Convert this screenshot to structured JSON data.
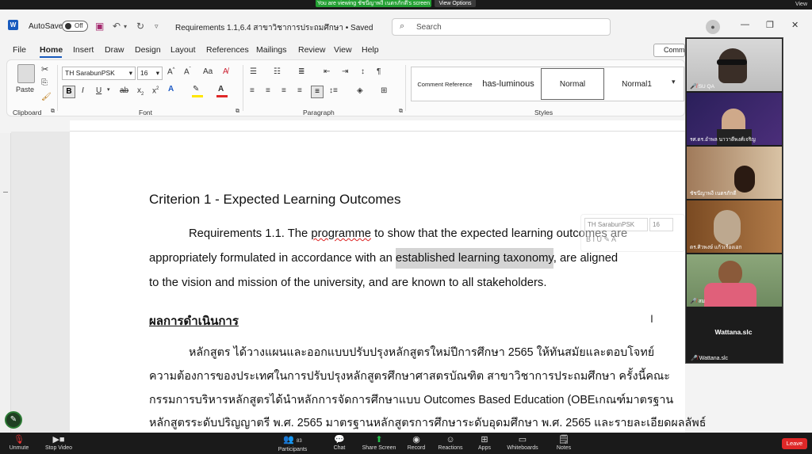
{
  "zoom_top": {
    "viewing_badge": "You are viewing ชัชนีญาพงี  เนตรภักดี's screen",
    "view_options": "View Options",
    "view_right": "View"
  },
  "word": {
    "autosave_label": "AutoSave",
    "autosave_state": "Off",
    "doc_title": "Requirements 1.1,6.4 สาขาวิชาการประถมศึกษา • Saved",
    "search_placeholder": "Search",
    "tabs": [
      "File",
      "Home",
      "Insert",
      "Draw",
      "Design",
      "Layout",
      "References",
      "Mailings",
      "Review",
      "View",
      "Help"
    ],
    "comments_button": "Comm",
    "share_button": "hare",
    "ribbon": {
      "paste_label": "Paste",
      "clipboard_group": "Clipboard",
      "font_name": "TH SarabunPSK",
      "font_size": "16",
      "font_group": "Font",
      "paragraph_group": "Paragraph",
      "styles_group": "Styles",
      "styles": [
        "Comment Reference",
        "has-luminous",
        "Normal",
        "Normal1"
      ]
    }
  },
  "document": {
    "heading": "Criterion 1 - Expected Learning Outcomes",
    "req_line1_a": "Requirements 1.1. The ",
    "req_line1_squiggle": "programme",
    "req_line1_b": " to show that the expected learning outcomes are",
    "req_line2_a": "appropriately formulated in accordance with an ",
    "req_line2_highlight": "established learning taxonomy",
    "req_line2_b": ", are aligned",
    "req_line3": "to the vision and mission of the university, and are known to all stakeholders.",
    "result_heading": "ผลการดำเนินการ",
    "thai_line1": "หลักสูตร ได้วางแผนและออกแบบปรับปรุงหลักสูตรใหม่ปีการศึกษา 2565 ให้ทันสมัยและตอบโจทย์",
    "thai_line2": "ความต้องการของประเทศในการปรับปรุงหลักสูตรศึกษาศาสตรบัณฑิต สาขาวิชาการประถมศึกษา ครั้งนี้คณะ",
    "thai_line3": "กรรมการบริหารหลักสูตรได้นำหลักการจัดการศึกษาแบบ Outcomes Based Education (OBEเกณฑ์มาตรฐาน",
    "thai_line4": "หลักสูตรระดับปริญญาตรี พ.ศ. 2565 มาตรฐานหลักสูตรการศึกษาระดับอุดมศึกษา พ.ศ. 2565 และรายละเอียดผลลัพธ์",
    "mini_toolbar_font": "TH SarabunPSK",
    "mini_toolbar_size": "16"
  },
  "participants": [
    {
      "name": "SU QA",
      "bg": "#cfcfcf"
    },
    {
      "name": "รศ.ดร.อำพล นาวาดีพงศ์เจริญ",
      "bg": "#3a2a6a"
    },
    {
      "name": "ชัชนีญาพงี  เนตรภักดี",
      "bg": "#8a6a4a"
    },
    {
      "name": "ดร.ศิวพงษ์ แก้วเรืองเอก",
      "bg": "#6b4a2a"
    },
    {
      "name": "สม",
      "bg": "#5b7a5a"
    }
  ],
  "featured_participant": "Wattana.slc",
  "featured_participant_label": "Wattana.slc",
  "zoom_bottom": {
    "unmute": "Unmute",
    "stop_video": "Stop Video",
    "participants": "Participants",
    "participants_count": "83",
    "chat": "Chat",
    "share_screen": "Share Screen",
    "record": "Record",
    "reactions": "Reactions",
    "apps": "Apps",
    "whiteboards": "Whiteboards",
    "notes": "Notes",
    "leave": "Leave"
  }
}
